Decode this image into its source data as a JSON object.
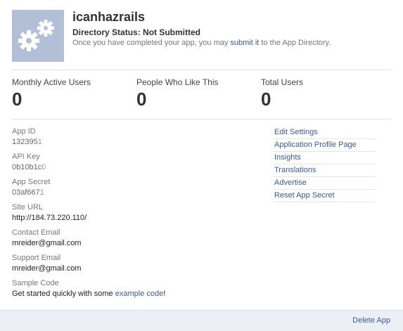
{
  "app": {
    "name": "icanhazrails",
    "directory_status": "Directory Status: Not Submitted",
    "note_prefix": "Once you have completed your app, you may ",
    "note_link": "submit it",
    "note_suffix": " to the App Directory.",
    "icon": "gears-icon"
  },
  "stats": [
    {
      "label": "Monthly Active Users",
      "value": "0"
    },
    {
      "label": "People Who Like This",
      "value": "0"
    },
    {
      "label": "Total Users",
      "value": "0"
    }
  ],
  "details": {
    "app_id_label": "App ID",
    "app_id_value": "1323951",
    "api_key_label": "API Key",
    "api_key_value": "0b10b1c0",
    "app_secret_label": "App Secret",
    "app_secret_value": "03af6671",
    "site_url_label": "Site URL",
    "site_url_value": "http://184.73.220.110/",
    "contact_email_label": "Contact Email",
    "contact_email_value": "mreider@gmail.com",
    "support_email_label": "Support Email",
    "support_email_value": "mreider@gmail.com",
    "sample_code_label": "Sample Code",
    "sample_code_prefix": "Get started quickly with some ",
    "sample_code_link": "example code",
    "sample_code_suffix": "!"
  },
  "links": [
    "Edit Settings",
    "Application Profile Page",
    "Insights",
    "Translations",
    "Advertise",
    "Reset App Secret"
  ],
  "footer": {
    "delete_label": "Delete App"
  },
  "colors": {
    "link": "#3b5998",
    "icon_bg": "#b3bfd6",
    "footer_bg": "#eceff5"
  }
}
